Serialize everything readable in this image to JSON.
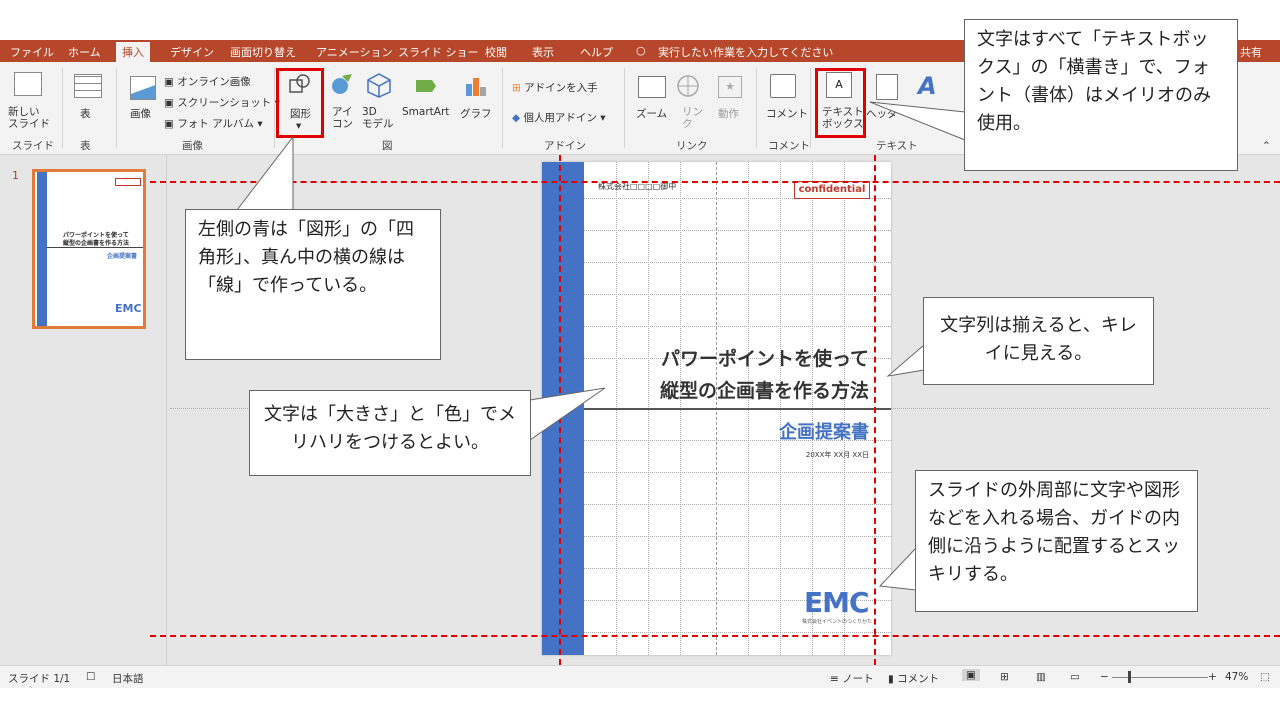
{
  "menu": {
    "tabs": [
      "ファイル",
      "ホーム",
      "挿入",
      "デザイン",
      "画面切り替え",
      "アニメーション",
      "スライド ショー",
      "校閲",
      "表示",
      "ヘルプ"
    ],
    "active_tab": "挿入",
    "tell_me": "実行したい作業を入力してください",
    "share": "共有"
  },
  "ribbon": {
    "new_slide": "新しい\nスライド",
    "table": "表",
    "image": "画像",
    "online_image": "オンライン画像",
    "screenshot": "スクリーンショット",
    "photo_album": "フォト アルバム",
    "shapes": "図形",
    "icons": "アイ\nコン",
    "model3d": "3D\nモデル",
    "smartart": "SmartArt",
    "graph": "グラフ",
    "get_addins": "アドインを入手",
    "my_addins": "個人用アドイン",
    "zoom": "ズーム",
    "link": "リン\nク",
    "action": "動作",
    "comment": "コメント",
    "textbox": "テキスト\nボックス",
    "header_footer": "ヘッダーと",
    "wordart": "ワード",
    "groups": {
      "slide": "スライド",
      "table": "表",
      "images": "画像",
      "illustrations": "図",
      "addins": "アドイン",
      "links": "リンク",
      "comments": "コメント",
      "text": "テキスト"
    }
  },
  "thumb": {
    "number": "1",
    "title_line1": "パワーポイントを使って",
    "title_line2": "縦型の企画書を作る方法",
    "subtitle": "企画提案書"
  },
  "slide": {
    "company": "株式会社□□□□御中",
    "badge": "confidential",
    "title_line1": "パワーポイントを使って",
    "title_line2": "縦型の企画書を作る方法",
    "subtitle": "企画提案書",
    "date": "20XX年 XX月 XX日",
    "logo": "EMC",
    "logo_caption": "株式会社イベントのつくりかた",
    "accent_color": "#4472c4",
    "subtitle_color": "#4472c4",
    "badge_color": "#c0392b"
  },
  "callouts": {
    "textbox_rule": "文字はすべて「テキストボックス」の「横書き」で、フォント（書体）はメイリオのみ使用。",
    "shapes_rule": "左側の青は「図形」の「四角形」、真ん中の横の線は「線」で作っている。",
    "align_rule": "文字列は揃えると、キレイに見える。",
    "emphasis_rule": "文字は「大きさ」と「色」でメリハリをつけるとよい。",
    "guide_rule": "スライドの外周部に文字や図形などを入れる場合、ガイドの内側に沿うように配置するとスッキリする。"
  },
  "status": {
    "slide_count": "スライド 1/1",
    "language": "日本語",
    "notes": "ノート",
    "comments": "コメント",
    "zoom": "47%"
  }
}
